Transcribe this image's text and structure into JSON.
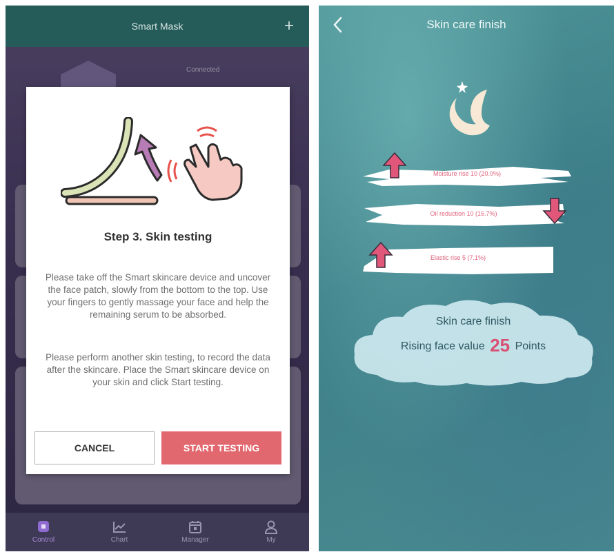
{
  "left": {
    "header": {
      "title": "Smart Mask",
      "add_icon": "plus-icon"
    },
    "background": {
      "status": "Connected"
    },
    "dialog": {
      "step_title": "Step 3. Skin testing",
      "paragraph1": "Please take off the Smart skincare device and uncover the face patch, slowly from the bottom to the top. Use your fingers to gently massage your face and help the remaining serum to be absorbed.",
      "paragraph2": "Please perform another skin testing, to record the data after the skincare. Place the Smart skincare device on your skin and click Start testing.",
      "cancel_label": "CANCEL",
      "start_label": "START TESTING",
      "colors": {
        "start_button": "#e2686f",
        "patch": "#d9e3b5",
        "patch_base": "#f0c4b4",
        "curl_arrow": "#b77bb5",
        "hand": "#f6c9c3",
        "waves": "#e8504a"
      }
    },
    "bottom_nav": {
      "items": [
        {
          "label": "Control",
          "icon": "control-icon",
          "active": true
        },
        {
          "label": "Chart",
          "icon": "chart-icon",
          "active": false
        },
        {
          "label": "Manager",
          "icon": "calendar-icon",
          "active": false
        },
        {
          "label": "My",
          "icon": "user-icon",
          "active": false
        }
      ]
    }
  },
  "right": {
    "header": {
      "title": "Skin care finish",
      "back_icon": "chevron-left-icon"
    },
    "results": [
      {
        "text": "Moisture rise 10 (20.0%)",
        "direction": "up"
      },
      {
        "text": "Oil reduction 10 (16.7%)",
        "direction": "down"
      },
      {
        "text": "Elastic rise 5 (7.1%)",
        "direction": "up"
      }
    ],
    "summary": {
      "title": "Skin care finish",
      "prefix": "Rising face value",
      "value": "25",
      "suffix": "Points"
    },
    "colors": {
      "accent": "#d94f72",
      "arrow": "#e0577a",
      "background": "#4e9598"
    }
  }
}
